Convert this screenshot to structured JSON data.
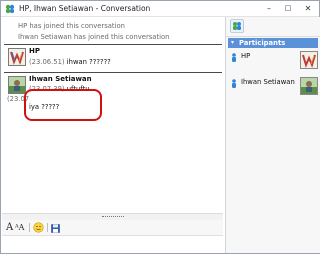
{
  "window": {
    "title": "HP, Ihwan Setiawan - Conversation",
    "controls": {
      "minimize": "–",
      "maximize": "□",
      "close": "✕"
    }
  },
  "chat": {
    "system_messages": [
      "HP has joined this conversation",
      "Ihwan Setiawan has joined this conversation"
    ],
    "blocks": [
      {
        "sender": "HP",
        "messages": [
          {
            "time": "(23.06.51)",
            "text": "ihwan ??????"
          }
        ]
      },
      {
        "sender": "Ihwan Setiawan",
        "messages": [
          {
            "time": "(23.07.39)",
            "text": "uftuftu"
          },
          {
            "time": "(23.07.46)",
            "text": "iya ?????"
          }
        ]
      }
    ],
    "left_margin_time_fragment": "(23.07"
  },
  "toolbar": {
    "items": [
      {
        "name": "font-icon",
        "glyph": "A"
      },
      {
        "name": "font-size-icon",
        "glyph": "ᴬA"
      },
      {
        "name": "emoticon-icon",
        "glyph": "☺"
      },
      {
        "name": "save-icon",
        "glyph": "🖫"
      }
    ]
  },
  "sidebar": {
    "participants_header": "Participants",
    "participants": [
      {
        "name": "HP"
      },
      {
        "name": "Ihwan Setiawan"
      }
    ]
  },
  "colors": {
    "accent": "#5a91d8",
    "highlight_box": "#d11111"
  }
}
